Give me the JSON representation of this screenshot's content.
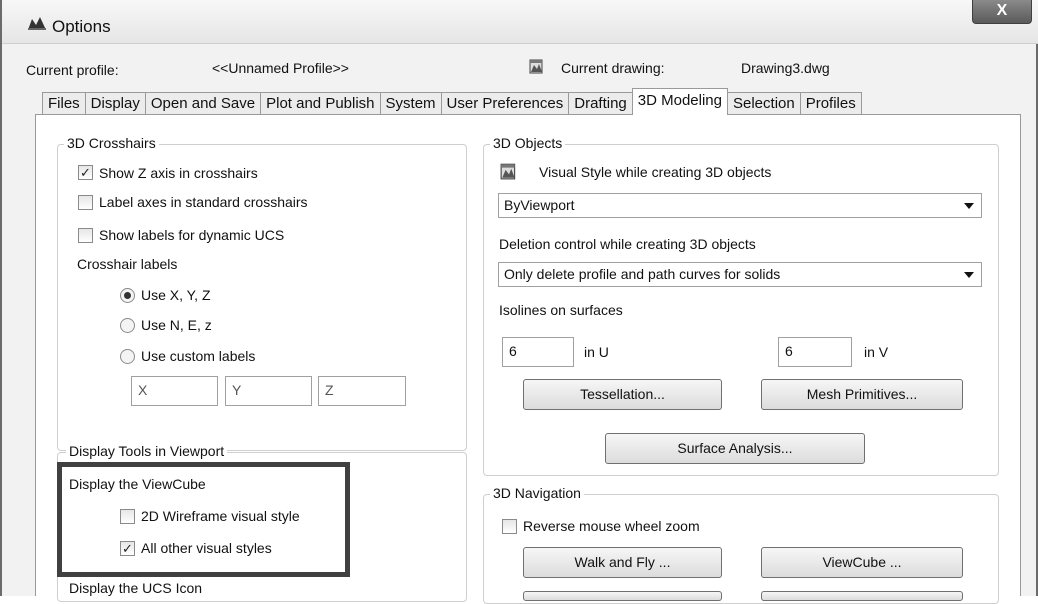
{
  "window": {
    "title": "Options",
    "close_label": "X"
  },
  "header": {
    "current_profile_label": "Current profile:",
    "current_profile_value": "<<Unnamed Profile>>",
    "current_drawing_label": "Current drawing:",
    "current_drawing_value": "Drawing3.dwg"
  },
  "tabs": [
    {
      "label": "Files"
    },
    {
      "label": "Display"
    },
    {
      "label": "Open and Save"
    },
    {
      "label": "Plot and Publish"
    },
    {
      "label": "System"
    },
    {
      "label": "User Preferences"
    },
    {
      "label": "Drafting"
    },
    {
      "label": "3D Modeling"
    },
    {
      "label": "Selection"
    },
    {
      "label": "Profiles"
    }
  ],
  "crosshairs": {
    "title": "3D Crosshairs",
    "show_z": {
      "label": "Show Z axis in crosshairs",
      "checked": true
    },
    "label_axes": {
      "label": "Label axes in standard crosshairs",
      "checked": false
    },
    "dynamic_ucs": {
      "label": "Show labels for dynamic UCS",
      "checked": false
    },
    "labels_title": "Crosshair labels",
    "radio_xyz": "Use X, Y, Z",
    "radio_nez": "Use N, E, z",
    "radio_custom": "Use custom labels",
    "custom_x": "X",
    "custom_y": "Y",
    "custom_z": "Z"
  },
  "display_tools": {
    "title": "Display Tools in Viewport",
    "viewcube_title": "Display the ViewCube",
    "wireframe": {
      "label": "2D Wireframe visual style",
      "checked": false
    },
    "other_styles": {
      "label": "All other visual styles",
      "checked": true
    },
    "ucs_title": "Display the UCS Icon"
  },
  "objects": {
    "title": "3D Objects",
    "visual_style_label": "Visual Style while creating 3D objects",
    "visual_style_value": "ByViewport",
    "deletion_label": "Deletion control while creating 3D objects",
    "deletion_value": "Only delete profile and path curves for solids",
    "isolines_label": "Isolines on surfaces",
    "isolines_u_value": "6",
    "isolines_u_unit": "in U",
    "isolines_v_value": "6",
    "isolines_v_unit": "in V",
    "tessellation_label": "Tessellation...",
    "mesh_label": "Mesh Primitives...",
    "surface_analysis_label": "Surface Analysis..."
  },
  "navigation": {
    "title": "3D Navigation",
    "reverse_zoom": {
      "label": "Reverse mouse wheel zoom",
      "checked": false
    },
    "walk_fly_label": "Walk and Fly ...",
    "viewcube_label": "ViewCube ..."
  }
}
